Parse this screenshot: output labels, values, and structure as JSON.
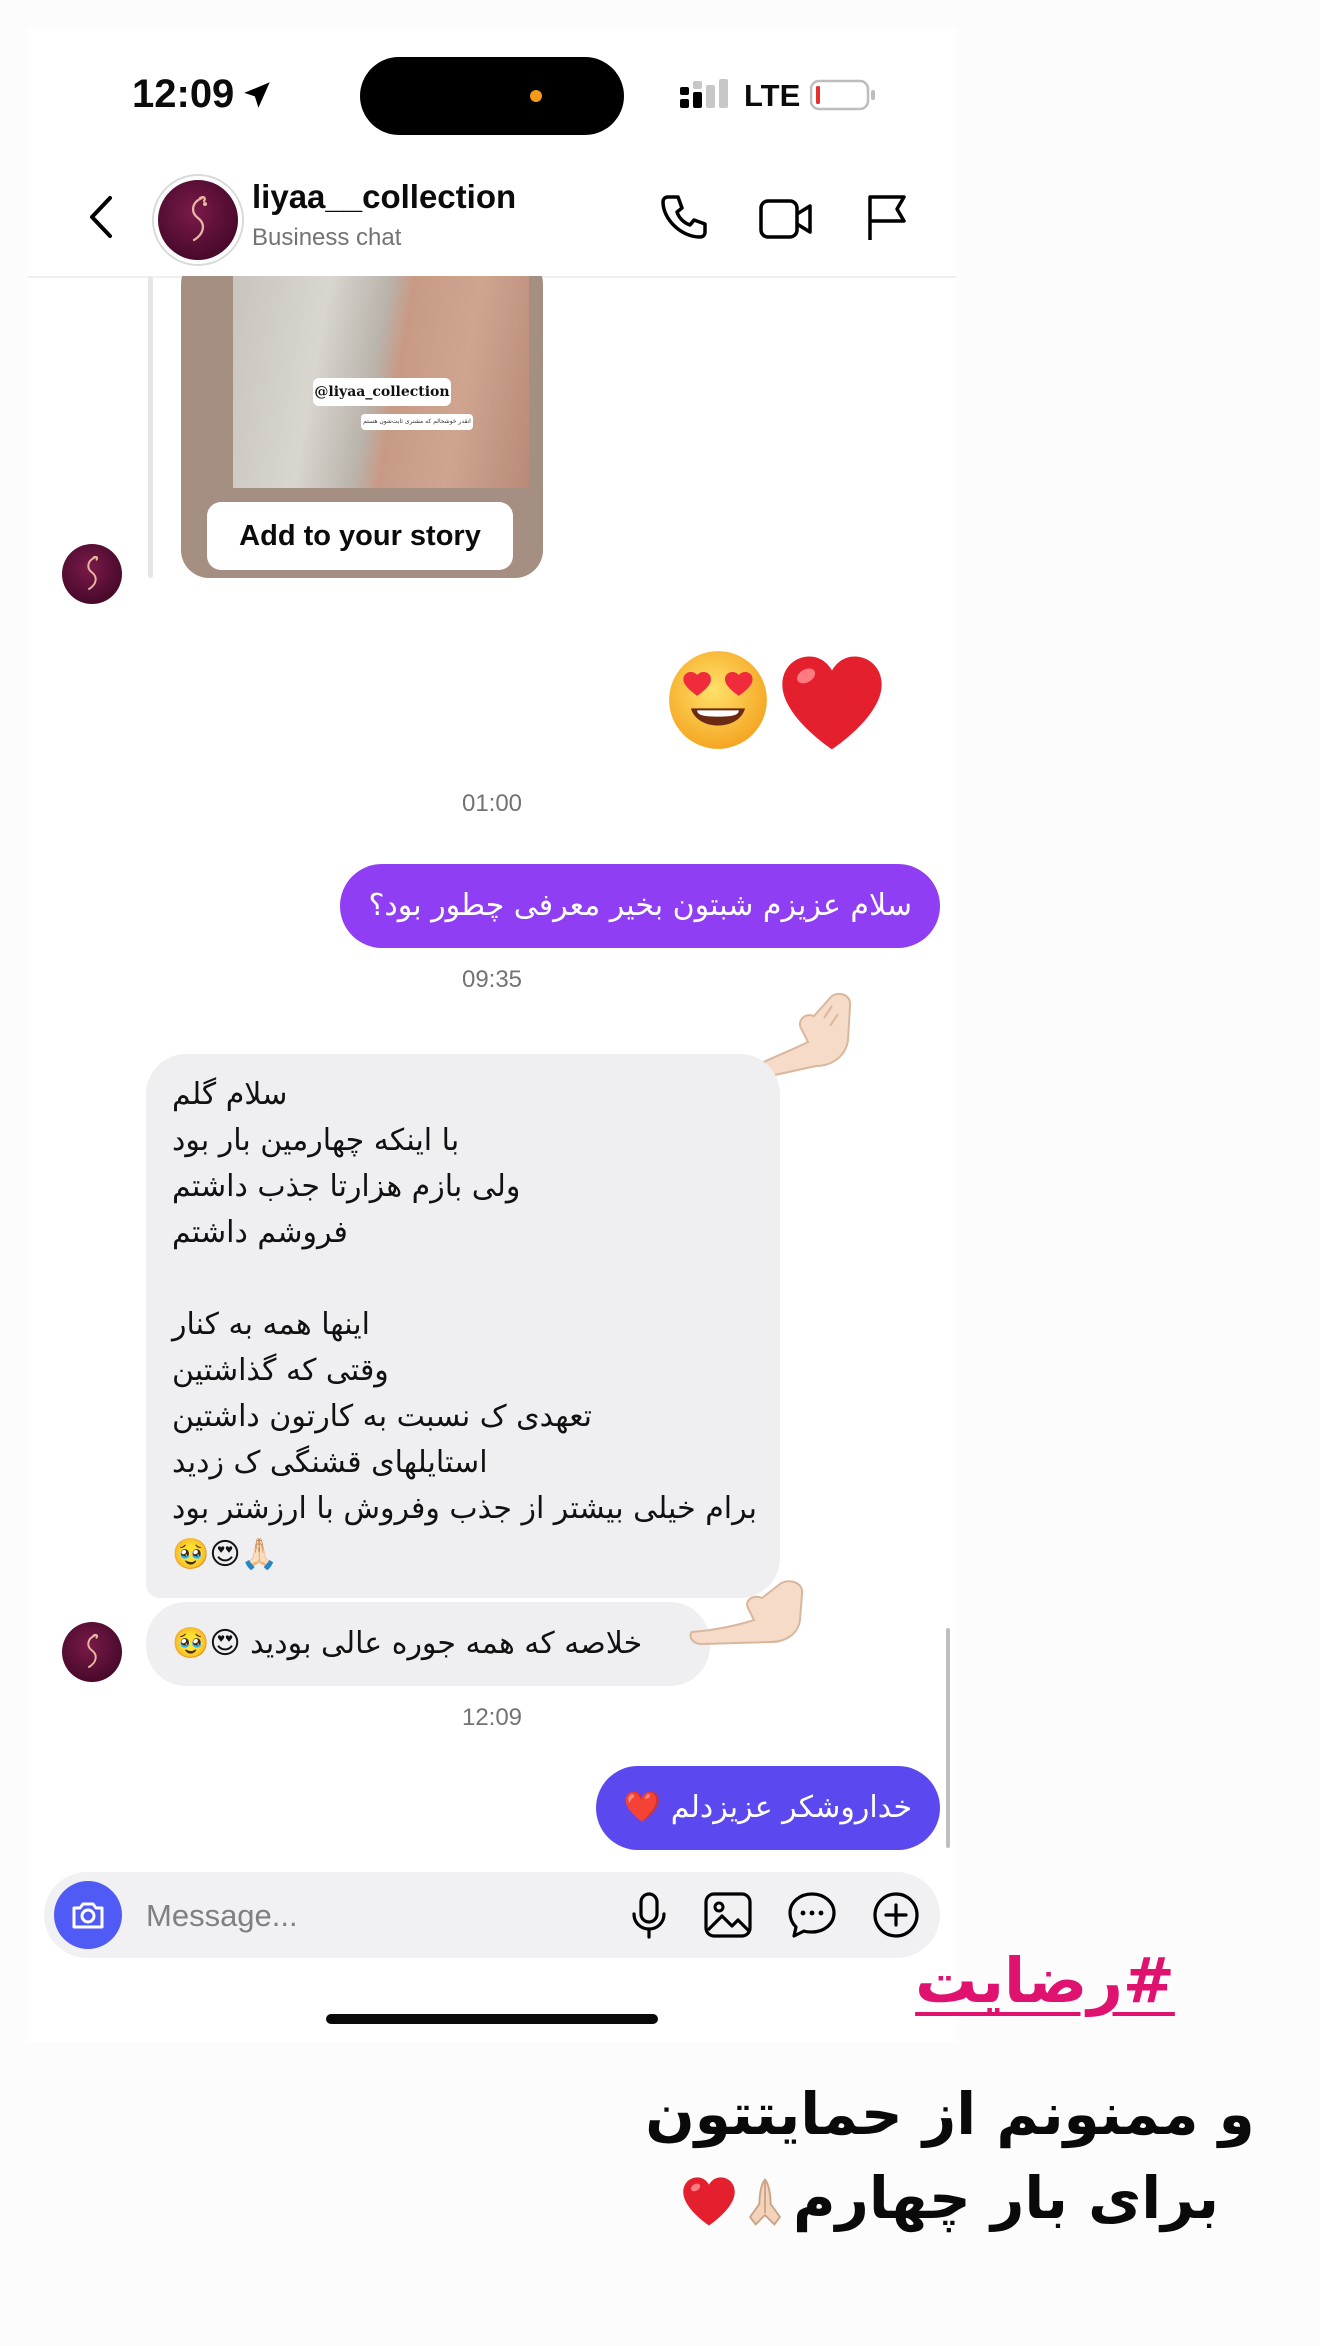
{
  "status_bar": {
    "time": "12:09",
    "network": "LTE"
  },
  "header": {
    "contact_name": "liyaa__collection",
    "contact_subtitle": "Business chat"
  },
  "story_card": {
    "tag": "@liyaa_collection",
    "caption": "انقدر خوشحالم که مشتری ثابت‌شون هستم",
    "button_label": "Add to your story"
  },
  "messages": [
    {
      "type": "timestamp",
      "text": "01:00"
    },
    {
      "type": "outgoing",
      "text": "سلام عزیزم شبتون بخیر معرفی چطور بود؟"
    },
    {
      "type": "timestamp",
      "text": "09:35"
    },
    {
      "type": "incoming",
      "lines": [
        "سلام گلم",
        "با اینکه چهارمین بار بود",
        "ولی بازم هزارتا جذب داشتم",
        "فروشم داشتم",
        "",
        "اینها همه به کنار",
        "وقتی که گذاشتین",
        "تعهدی ک نسبت به کارتون داشتین",
        "استایلهای قشنگی ک زدید",
        "برام خیلی بیشتر از جذب وفروش با ارزشتر بود",
        "🥹😍🙏🏻"
      ]
    },
    {
      "type": "incoming",
      "text": "خلاصه که همه جوره عالی بودید 😍🥹"
    },
    {
      "type": "timestamp",
      "text": "12:09"
    },
    {
      "type": "outgoing",
      "text": "خداروشکر عزیزدلم ❤️"
    }
  ],
  "composer": {
    "placeholder": "Message..."
  },
  "overlay": {
    "hashtag": "#رضایت",
    "line1": "و ممنونم از حمایتتون",
    "line2": "برای بار چهارم"
  },
  "colors": {
    "outgoing_purple": "#8f3ef3",
    "outgoing_blue": "#5b48ef",
    "incoming_gray": "#efeff1",
    "camera_button": "#4f5bf4",
    "hashtag_pink": "#e0126f"
  },
  "icons": [
    "location-arrow-icon",
    "signal-icon",
    "battery-icon",
    "back-icon",
    "phone-icon",
    "video-icon",
    "flag-icon",
    "camera-icon",
    "mic-icon",
    "gallery-icon",
    "sticker-icon",
    "plus-icon",
    "heart-eyes-emoji",
    "red-heart-emoji",
    "pointing-hand-emoji"
  ]
}
